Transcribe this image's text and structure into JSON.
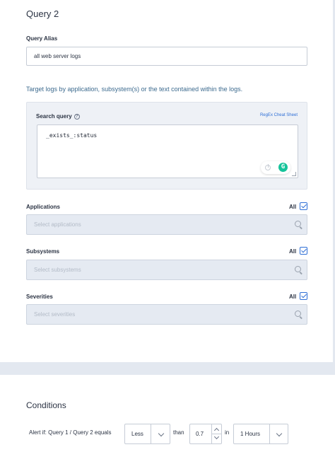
{
  "query": {
    "title": "Query 2",
    "alias_label": "Query Alias",
    "alias_value": "all web server logs",
    "target_text": "Target logs by application, subsystem(s) or the text contained within the logs.",
    "search_label": "Search query",
    "help_symbol": "?",
    "regex_link": "RegEx Cheat Sheet",
    "search_value": "_exists_:status",
    "grammarly_letter": "G"
  },
  "filters": [
    {
      "label": "Applications",
      "all_label": "All",
      "checked": true,
      "placeholder": "Select applications"
    },
    {
      "label": "Subsystems",
      "all_label": "All",
      "checked": true,
      "placeholder": "Select subsystems"
    },
    {
      "label": "Severities",
      "all_label": "All",
      "checked": true,
      "placeholder": "Select severities"
    }
  ],
  "conditions": {
    "title": "Conditions",
    "alert_label": "Alert if: Query 1 / Query 2 equals",
    "comparison": "Less",
    "than_label": "than",
    "threshold": "0.7",
    "in_label": "in",
    "timeframe": "1 Hours"
  },
  "colors": {
    "accent": "#2f6fd6",
    "grammarly": "#15c39a",
    "target_text": "#3c6a8e"
  }
}
